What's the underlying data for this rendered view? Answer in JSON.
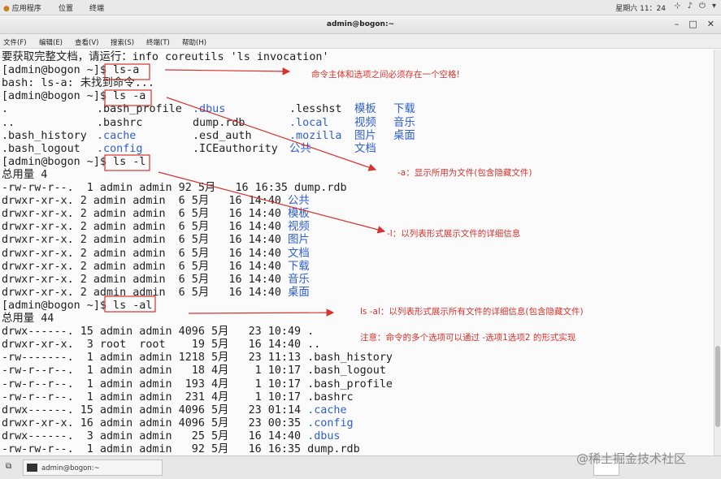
{
  "topbar": {
    "apps_label": "应用程序",
    "places_label": "位置",
    "terminal_label": "终端",
    "clock": "星期六 11：24"
  },
  "window": {
    "title": "admin@bogon:~"
  },
  "menubar": {
    "file": "文件(F)",
    "edit": "编辑(E)",
    "view": "查看(V)",
    "search": "搜索(S)",
    "terminal": "终端(T)",
    "help": "帮助(H)"
  },
  "terminal": {
    "lines": [
      [
        {
          "t": "要获取完整文档，请运行：info coreutils 'ls invocation'"
        }
      ],
      [
        {
          "t": "[admin@bogon ~]$ ls-a"
        }
      ],
      [
        {
          "t": "bash: ls-a: 未找到命令..."
        }
      ],
      [
        {
          "t": "[admin@bogon ~]$ ls -a"
        }
      ],
      [
        {
          "t": "."
        },
        {
          "t": ".bash_profile"
        },
        {
          "t": ".dbus",
          "c": "blue"
        },
        {
          "t": ".lesshst"
        },
        {
          "t": "模板",
          "c": "blue"
        },
        {
          "t": "下载",
          "c": "blue"
        }
      ],
      [
        {
          "t": ".."
        },
        {
          "t": ".bashrc"
        },
        {
          "t": "dump.rdb"
        },
        {
          "t": ".local",
          "c": "blue"
        },
        {
          "t": "视频",
          "c": "blue"
        },
        {
          "t": "音乐",
          "c": "blue"
        }
      ],
      [
        {
          "t": ".bash_history"
        },
        {
          "t": ".cache",
          "c": "blue"
        },
        {
          "t": ".esd_auth"
        },
        {
          "t": ".mozilla",
          "c": "blue"
        },
        {
          "t": "图片",
          "c": "blue"
        },
        {
          "t": "桌面",
          "c": "blue"
        }
      ],
      [
        {
          "t": ".bash_logout"
        },
        {
          "t": ".config",
          "c": "blue"
        },
        {
          "t": ".ICEauthority"
        },
        {
          "t": "公共",
          "c": "blue"
        },
        {
          "t": "文档",
          "c": "blue"
        }
      ],
      [
        {
          "t": "[admin@bogon ~]$ ls -l"
        }
      ],
      [
        {
          "t": "总用量 4"
        }
      ],
      [
        {
          "t": "-rw-rw-r--.  1 admin admin 92 5月   16 16:35 dump.rdb"
        }
      ],
      [
        {
          "t": "drwxr-xr-x. 2 admin admin  6 5月   16 14:40 "
        },
        {
          "t": "公共",
          "c": "blue"
        }
      ],
      [
        {
          "t": "drwxr-xr-x. 2 admin admin  6 5月   16 14:40 "
        },
        {
          "t": "模板",
          "c": "blue"
        }
      ],
      [
        {
          "t": "drwxr-xr-x. 2 admin admin  6 5月   16 14:40 "
        },
        {
          "t": "视频",
          "c": "blue"
        }
      ],
      [
        {
          "t": "drwxr-xr-x. 2 admin admin  6 5月   16 14:40 "
        },
        {
          "t": "图片",
          "c": "blue"
        }
      ],
      [
        {
          "t": "drwxr-xr-x. 2 admin admin  6 5月   16 14:40 "
        },
        {
          "t": "文档",
          "c": "blue"
        }
      ],
      [
        {
          "t": "drwxr-xr-x. 2 admin admin  6 5月   16 14:40 "
        },
        {
          "t": "下载",
          "c": "blue"
        }
      ],
      [
        {
          "t": "drwxr-xr-x. 2 admin admin  6 5月   16 14:40 "
        },
        {
          "t": "音乐",
          "c": "blue"
        }
      ],
      [
        {
          "t": "drwxr-xr-x. 2 admin admin  6 5月   16 14:40 "
        },
        {
          "t": "桌面",
          "c": "blue"
        }
      ],
      [
        {
          "t": "[admin@bogon ~]$ ls -al"
        }
      ],
      [
        {
          "t": "总用量 44"
        }
      ],
      [
        {
          "t": "drwx------. 15 admin admin 4096 5月   23 10:49 ."
        }
      ],
      [
        {
          "t": "drwxr-xr-x.  3 root  root    19 5月   16 14:40 .."
        }
      ],
      [
        {
          "t": "-rw-------.  1 admin admin 1218 5月   23 11:13 .bash_history"
        }
      ],
      [
        {
          "t": "-rw-r--r--.  1 admin admin   18 4月    1 10:17 .bash_logout"
        }
      ],
      [
        {
          "t": "-rw-r--r--.  1 admin admin  193 4月    1 10:17 .bash_profile"
        }
      ],
      [
        {
          "t": "-rw-r--r--.  1 admin admin  231 4月    1 10:17 .bashrc"
        }
      ],
      [
        {
          "t": "drwx------. 15 admin admin 4096 5月   23 01:14 "
        },
        {
          "t": ".cache",
          "c": "blue"
        }
      ],
      [
        {
          "t": "drwxr-xr-x. 16 admin admin 4096 5月   23 00:35 "
        },
        {
          "t": ".config",
          "c": "blue"
        }
      ],
      [
        {
          "t": "drwx------.  3 admin admin   25 5月   16 14:40 "
        },
        {
          "t": ".dbus",
          "c": "blue"
        }
      ],
      [
        {
          "t": "-rw-rw-r--.  1 admin admin   92 5月   16 16:35 dump.rdb"
        }
      ]
    ]
  },
  "annotations": {
    "a1": "命令主体和选项之间必须存在一个空格!",
    "a2": "-a：显示所用为文件(包含隐藏文件)",
    "a3": "-l：以列表形式展示文件的详细信息",
    "a4": "ls -al：以列表形式展示所有文件的详细信息(包含隐藏文件)",
    "a5": "注意：命令的多个选项可以通过 -选项1选项2 的形式实现"
  },
  "taskbar": {
    "task_label": "admin@bogon:~"
  },
  "watermark": "@稀土掘金技术社区",
  "colors": {
    "annotation": "#d6322e",
    "directory": "#2f5fd0"
  }
}
